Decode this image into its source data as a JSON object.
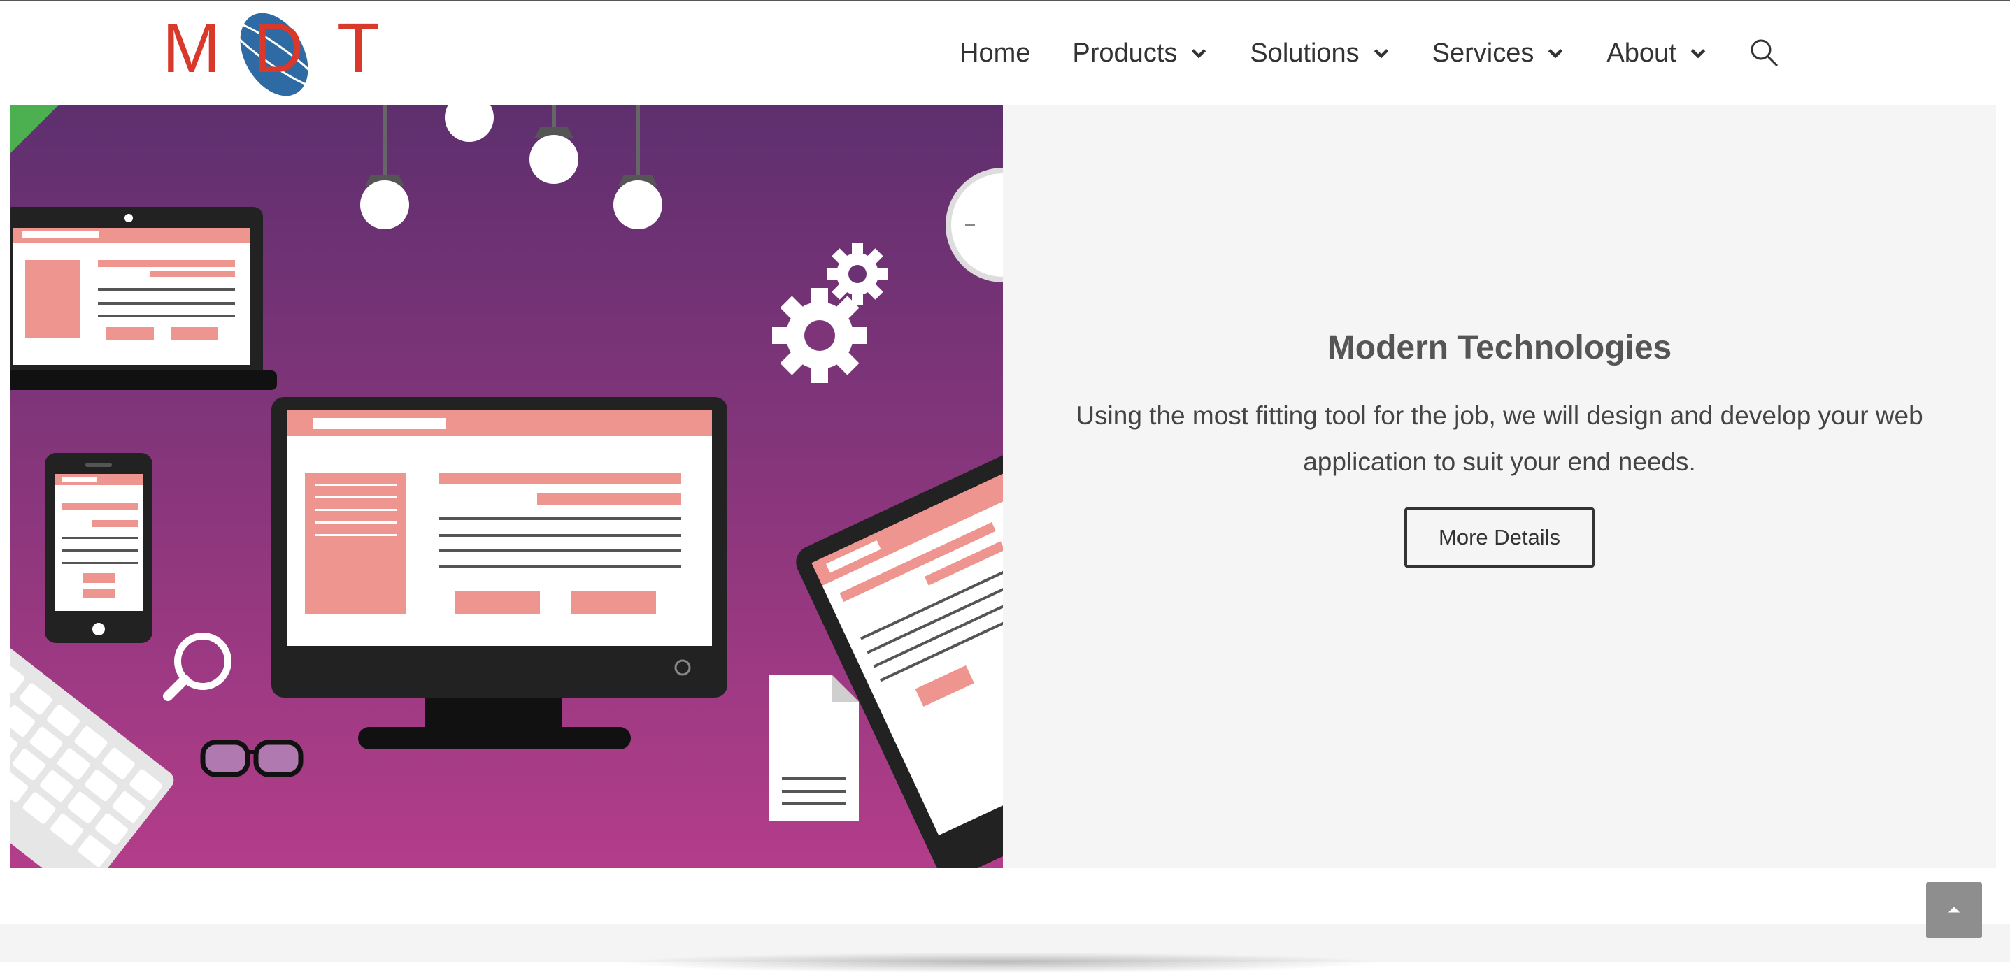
{
  "logo": {
    "text_left": "M",
    "text_mid": "D",
    "text_right": "T",
    "red": "#d8392b",
    "blue": "#2e6aa3"
  },
  "nav": {
    "items": [
      {
        "label": "Home",
        "dropdown": false
      },
      {
        "label": "Products",
        "dropdown": true
      },
      {
        "label": "Solutions",
        "dropdown": true
      },
      {
        "label": "Services",
        "dropdown": true
      },
      {
        "label": "About",
        "dropdown": true
      }
    ],
    "search_icon": "search-icon"
  },
  "hero": {
    "title": "Modern Technologies",
    "description": "Using the most fitting tool for the job, we will design and develop your web application to suit your end needs.",
    "button_label": "More Details"
  },
  "colors": {
    "accent_green": "#4caf50",
    "purple_top": "#5e2f6e",
    "purple_bottom": "#b33d8a",
    "panel_bg": "#f5f5f5",
    "pink": "#ef9590"
  },
  "scroll_top_icon": "chevron-up-icon"
}
